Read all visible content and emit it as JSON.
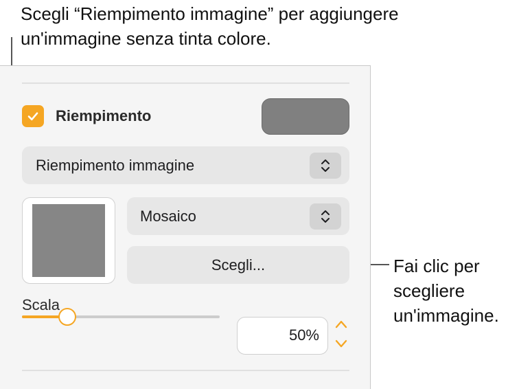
{
  "callouts": {
    "top_line1": "Scegli “Riempimento immagine” per aggiungere",
    "top_line2": "un'immagine senza tinta colore.",
    "right_line1": "Fai clic per",
    "right_line2": "scegliere",
    "right_line3": "un'immagine."
  },
  "fill": {
    "checked": true,
    "label": "Riempimento",
    "color_well_color": "#808080"
  },
  "fill_type_popup": {
    "selected": "Riempimento immagine"
  },
  "image_scaling_popup": {
    "selected": "Mosaico"
  },
  "choose_button": {
    "label": "Scegli..."
  },
  "scale": {
    "label": "Scala",
    "value_text": "50%",
    "slider_fraction": 0.23
  },
  "colors": {
    "accent": "#f5a623",
    "panel_background": "#f5f5f5",
    "control_background": "#e7e7e7"
  },
  "icons": {
    "checkbox": "checkmark-icon",
    "popup_stepper": "chevron-up-down-icon",
    "field_stepper": "chevron-up-down-icon"
  }
}
